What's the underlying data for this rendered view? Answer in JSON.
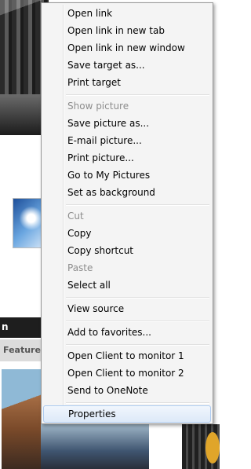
{
  "menu": {
    "items": [
      {
        "label": "Open link",
        "enabled": true
      },
      {
        "label": "Open link in new tab",
        "enabled": true
      },
      {
        "label": "Open link in new window",
        "enabled": true
      },
      {
        "label": "Save target as...",
        "enabled": true
      },
      {
        "label": "Print target",
        "enabled": true
      },
      {
        "label": "Show picture",
        "enabled": false
      },
      {
        "label": "Save picture as...",
        "enabled": true
      },
      {
        "label": "E-mail picture...",
        "enabled": true
      },
      {
        "label": "Print picture...",
        "enabled": true
      },
      {
        "label": "Go to My Pictures",
        "enabled": true
      },
      {
        "label": "Set as background",
        "enabled": true
      },
      {
        "label": "Cut",
        "enabled": false
      },
      {
        "label": "Copy",
        "enabled": true
      },
      {
        "label": "Copy shortcut",
        "enabled": true
      },
      {
        "label": "Paste",
        "enabled": false
      },
      {
        "label": "Select all",
        "enabled": true
      },
      {
        "label": "View source",
        "enabled": true
      },
      {
        "label": "Add to favorites...",
        "enabled": true
      },
      {
        "label": "Open Client to monitor 1",
        "enabled": true
      },
      {
        "label": "Open Client to monitor 2",
        "enabled": true
      },
      {
        "label": "Send to OneNote",
        "enabled": true
      },
      {
        "label": "Properties",
        "enabled": true,
        "highlighted": true
      }
    ]
  },
  "background": {
    "bar_text": "n",
    "featured_label": "Featured"
  },
  "colors": {
    "menu_bg": "#f4f4f4",
    "disabled_text": "#8d8d8d",
    "highlight_border": "#aecbf0",
    "link_blue": "#2a5caa"
  }
}
